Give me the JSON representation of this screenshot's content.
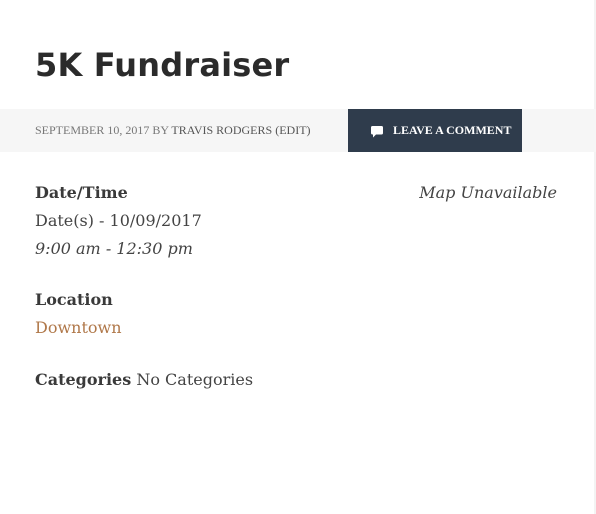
{
  "post": {
    "title": "5K Fundraiser",
    "meta": {
      "date": "September 10, 2017",
      "by": "by",
      "author": "Travis Rodgers",
      "edit": "(Edit)"
    },
    "comment_button": {
      "label": "Leave a Comment",
      "icon": "speech-bubble-icon"
    }
  },
  "event": {
    "datetime": {
      "heading": "Date/Time",
      "dates": "Date(s) - 10/09/2017",
      "time": "9:00 am - 12:30 pm"
    },
    "location": {
      "heading": "Location",
      "value": "Downtown"
    },
    "categories": {
      "heading": "Categories",
      "value": "No Categories"
    },
    "map": "Map Unavailable"
  },
  "colors": {
    "comment_button_bg": "#2f3c4c",
    "link": "#b0784a",
    "meta_bar_bg": "#f6f6f6"
  }
}
